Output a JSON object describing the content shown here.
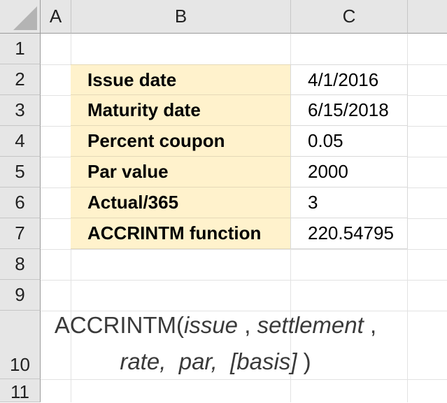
{
  "columns": [
    "A",
    "B",
    "C"
  ],
  "rows": [
    "1",
    "2",
    "3",
    "4",
    "5",
    "6",
    "7",
    "8",
    "9",
    "10",
    "11"
  ],
  "table": [
    {
      "label": "Issue date",
      "value": "4/1/2016"
    },
    {
      "label": "Maturity date",
      "value": "6/15/2018"
    },
    {
      "label": "Percent coupon",
      "value": "0.05"
    },
    {
      "label": "Par value",
      "value": "2000"
    },
    {
      "label": "Actual/365",
      "value": "3"
    },
    {
      "label": "ACCRINTM function",
      "value": "220.54795"
    }
  ],
  "syntax": {
    "fn": "ACCRINTM(",
    "issue": "issue",
    "sep1": " , ",
    "settlement": "settlement",
    "sep2": " ,",
    "rate": "rate,",
    "par": "par,",
    "basis": "[basis]",
    "close": " )"
  },
  "colors": {
    "label_fill": "#fff2cc",
    "header_fill": "#e6e6e6"
  }
}
